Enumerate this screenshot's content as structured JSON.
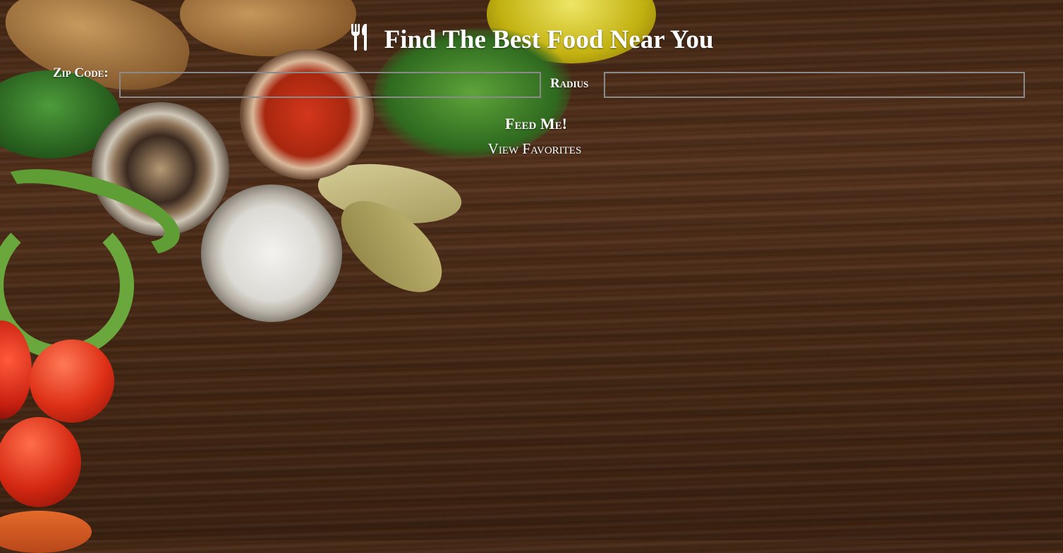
{
  "header": {
    "icon": "utensils-icon",
    "title": "Find The Best Food Near You"
  },
  "form": {
    "zip_label": "Zip Code:",
    "zip_value": "",
    "radius_label": "Radius",
    "radius_value": "",
    "submit_label": "Feed Me!"
  },
  "links": {
    "favorites_label": "View Favorites"
  },
  "colors": {
    "text": "#ffffff",
    "input_border": "#8a8a8a",
    "background": "#4a2c18"
  }
}
